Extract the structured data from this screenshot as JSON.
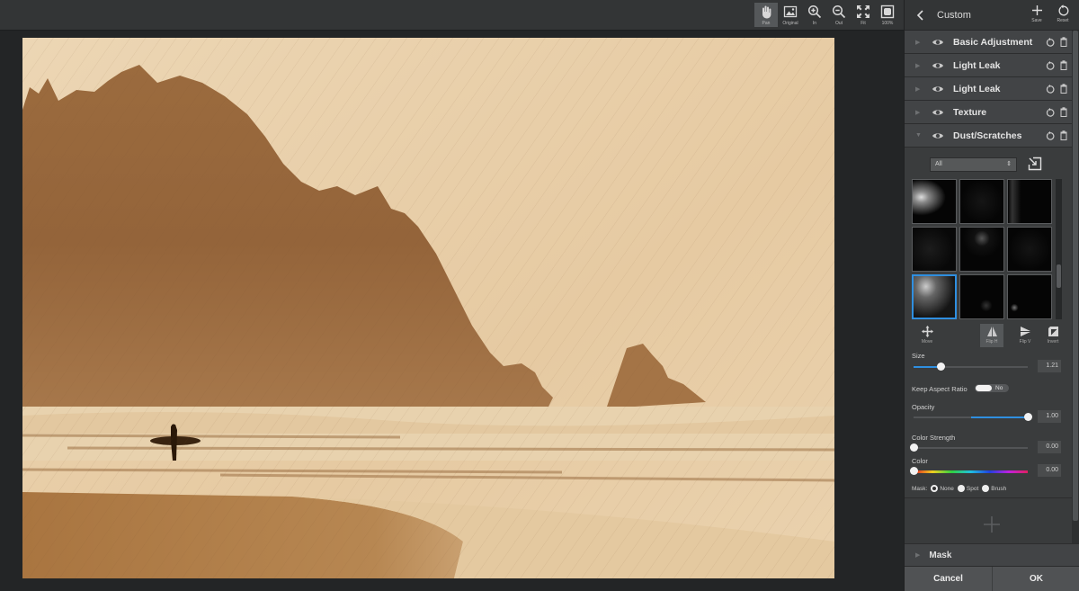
{
  "toolbar": {
    "tools": [
      {
        "id": "pan",
        "label": "Pan",
        "icon": "hand-icon",
        "active": true
      },
      {
        "id": "original",
        "label": "Original",
        "icon": "image-icon",
        "active": false
      },
      {
        "id": "zoom-in",
        "label": "In",
        "icon": "zoom-in-icon",
        "active": false
      },
      {
        "id": "zoom-out",
        "label": "Out",
        "icon": "zoom-out-icon",
        "active": false
      },
      {
        "id": "fit",
        "label": "Fit",
        "icon": "fit-icon",
        "active": false
      },
      {
        "id": "100",
        "label": "100%",
        "icon": "actual-size-icon",
        "active": false
      }
    ]
  },
  "panel": {
    "title": "Custom",
    "save_label": "Save",
    "reset_label": "Reset",
    "layers": [
      {
        "name": "Basic Adjustment",
        "expanded": false
      },
      {
        "name": "Light Leak",
        "expanded": false
      },
      {
        "name": "Light Leak",
        "expanded": false
      },
      {
        "name": "Texture",
        "expanded": false
      },
      {
        "name": "Dust/Scratches",
        "expanded": true
      }
    ],
    "dust": {
      "category": "All",
      "thumbnails_count": 9,
      "selected_thumbnail": 7,
      "ops": [
        {
          "label": "Move",
          "icon": "move-icon",
          "active": false
        },
        {
          "label": "Flip H",
          "icon": "flip-horizontal-icon",
          "active": true
        },
        {
          "label": "Flip V",
          "icon": "flip-vertical-icon",
          "active": false
        },
        {
          "label": "Invert",
          "icon": "invert-icon",
          "active": false
        }
      ],
      "size": {
        "label": "Size",
        "value": "1.21",
        "fraction": 0.24
      },
      "keep_aspect": {
        "label": "Keep Aspect Ratio",
        "state": "No"
      },
      "opacity": {
        "label": "Opacity",
        "value": "1.00",
        "fraction": 1.0
      },
      "color_strength": {
        "label": "Color Strength",
        "value": "0.00",
        "fraction": 0.0
      },
      "color": {
        "label": "Color",
        "value": "0.00",
        "fraction": 0.0
      },
      "mask": {
        "label": "Mask:",
        "options": [
          "None",
          "Spot",
          "Brush"
        ],
        "selected": "None"
      }
    },
    "mask_section": "Mask",
    "cancel_label": "Cancel",
    "ok_label": "OK"
  }
}
